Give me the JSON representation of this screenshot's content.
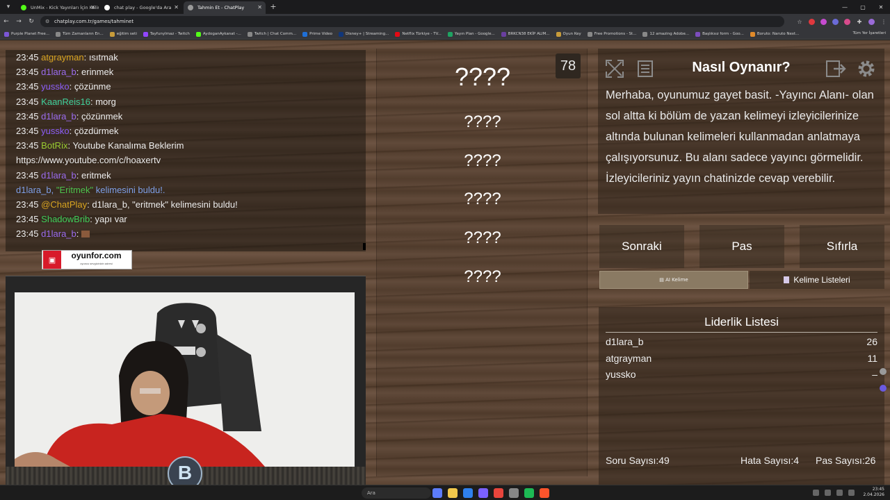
{
  "browser": {
    "tabs": [
      {
        "title": "UnMix - Kick Yayınları İçin Kelim",
        "color": "#53fc18",
        "active": false
      },
      {
        "title": "chat play - Google'da Ara",
        "color": "#ffffff",
        "active": false
      },
      {
        "title": "Tahmin Et - ChatPlay",
        "color": "#9a9a9a",
        "active": true
      }
    ],
    "url": "chatplay.com.tr/games/tahminet",
    "bookmarks": [
      "Purple Planet Free...",
      "Tüm Zamanların En...",
      "eğitim seti",
      "Tayfunylmaz - Twitch",
      "AydoganAykanat -...",
      "Twitch | Chat Comm...",
      "Prime Video",
      "Disney+ | Streaming...",
      "Netflix Türkiye - TV...",
      "Yayın Plan - Google...",
      "BRKCN38 EKİP ALIM...",
      "Oyun Key",
      "Free Promotions - St...",
      "12 amazing Adobe...",
      "Başlıksız form - Goo...",
      "Boruto: Naruto Next..."
    ],
    "all_bookmarks": "Tüm Yer İşaretleri"
  },
  "chat": {
    "messages": [
      {
        "time": "23:45",
        "user": "atgrayman",
        "color": "#daa520",
        "text": ": ısıtmak"
      },
      {
        "time": "23:45",
        "user": "d1lara_b",
        "color": "#9b6cf0",
        "text": ": erinmek"
      },
      {
        "time": "23:45",
        "user": "yussko",
        "color": "#8a5cf5",
        "text": ": çözünme"
      },
      {
        "time": "23:45",
        "user": "KaanReis16",
        "color": "#3fcf9a",
        "text": ": morg"
      },
      {
        "time": "23:45",
        "user": "d1lara_b",
        "color": "#9b6cf0",
        "text": ": çözünmek"
      },
      {
        "time": "23:45",
        "user": "yussko",
        "color": "#8a5cf5",
        "text": ": çözdürmek"
      },
      {
        "time": "23:45",
        "user": "BotRix",
        "color": "#9acd32",
        "text": ": Youtube Kanalıma Beklerim"
      },
      {
        "time": "",
        "user": "",
        "color": "#ececec",
        "text": "https://www.youtube.com/c/hoaxertv"
      },
      {
        "time": "23:45",
        "user": "d1lara_b",
        "color": "#9b6cf0",
        "text": ": eritmek"
      },
      {
        "time": "23:45",
        "user": "@ChatPlay",
        "color": "#daa520",
        "text": ": d1lara_b, \"eritmek\" kelimesini buldu!"
      },
      {
        "time": "23:45",
        "user": "ShadowBrib",
        "color": "#3fcf5a",
        "text": ": yapı var"
      },
      {
        "time": "23:45",
        "user": "d1lara_b",
        "color": "#9b6cf0",
        "text": ":"
      }
    ],
    "system": {
      "user": "d1lara_b, ",
      "word": "\"Eritmek\"",
      "rest": " kelimesini buldu!."
    }
  },
  "sponsor": {
    "name": "oyunfor.com",
    "tagline": "oyuncu sevgicinizin adresi"
  },
  "cam": {
    "logo": "B"
  },
  "game": {
    "counter": "78",
    "words": [
      "????",
      "????",
      "????",
      "????",
      "????",
      "????"
    ],
    "howto_title": "Nasıl Oynanır?",
    "howto_text": "Merhaba, oyunumuz gayet basit. -Yayıncı Alanı- olan sol altta ki bölüm de yazan kelimeyi izleyicilerinize altında bulunan kelimeleri kullanmadan anlatmaya çalışıyorsunuz. Bu alanı sadece yayıncı görmelidir. İzleyicileriniz yayın chatinizde cevap verebilir.",
    "buttons": {
      "next": "Sonraki",
      "pass": "Pas",
      "reset": "Sıfırla",
      "ai": "AI Kelime",
      "lists": "Kelime Listeleri"
    },
    "leaderboard": {
      "title": "Liderlik Listesi",
      "rows": [
        {
          "name": "d1lara_b",
          "score": "26"
        },
        {
          "name": "atgrayman",
          "score": "11"
        },
        {
          "name": "yussko",
          "score": "–"
        }
      ]
    },
    "stats": {
      "questions": "Soru Sayısı:49",
      "errors": "Hata Sayısı:4",
      "passes": "Pas Sayısı:26"
    }
  },
  "taskbar": {
    "search": "Ara",
    "time": "23:45",
    "date": "2.04.2026"
  }
}
